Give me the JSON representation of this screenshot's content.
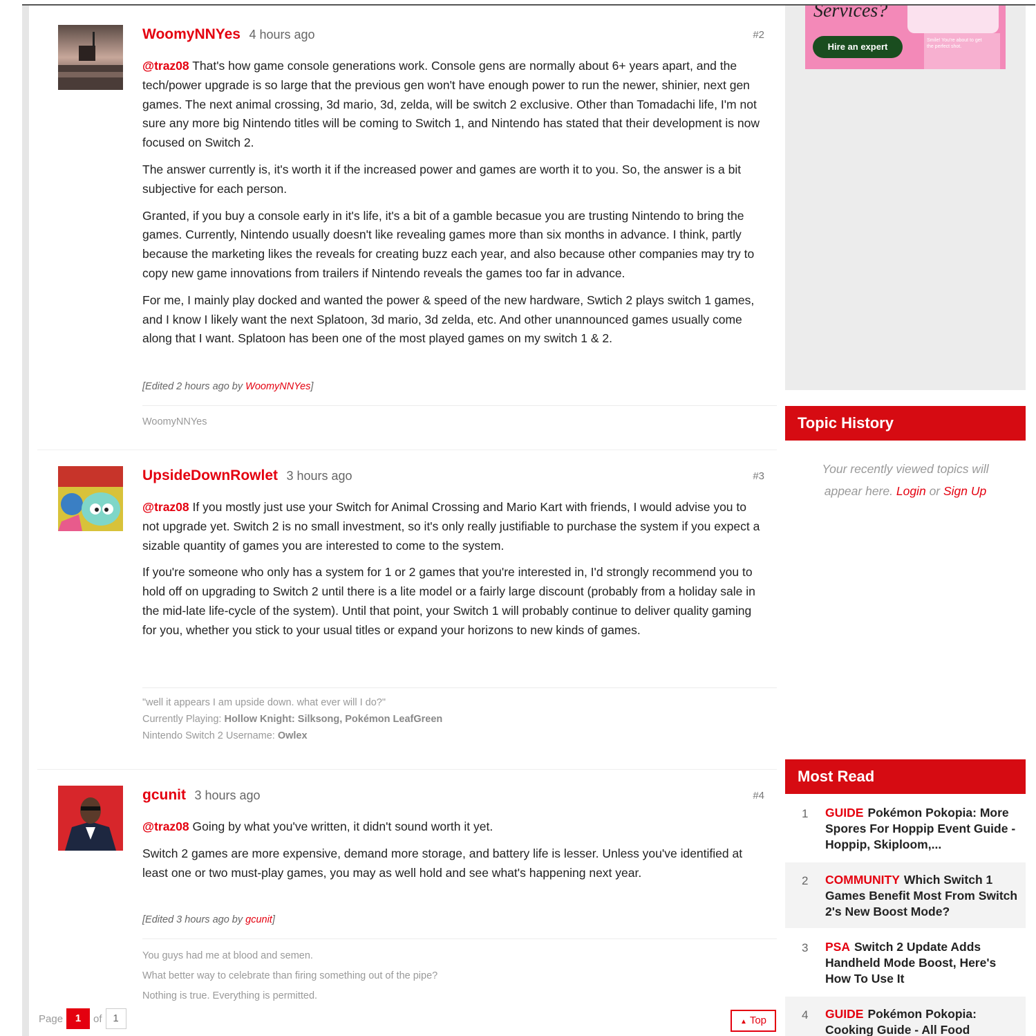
{
  "posts": [
    {
      "user": "WoomyNNYes",
      "ago": "4 hours ago",
      "num": "#2",
      "mention": "@traz08",
      "paragraphs": [
        "That's how game console generations work. Console gens are normally about 6+ years apart, and the tech/power upgrade is so large that the previous gen won't have enough power to run the newer, shinier, next gen games. The next animal crossing, 3d mario, 3d, zelda, will be switch 2 exclusive. Other than Tomadachi life, I'm not sure any more big Nintendo titles will be coming to Switch 1, and Nintendo has stated that their development is now focused on Switch 2.",
        "The answer currently is, it's worth it if the increased power and games are worth it to you. So, the answer is a bit subjective for each person.",
        "Granted, if you buy a console early in it's life, it's a bit of a gamble becasue you are trusting Nintendo to bring the games. Currently, Nintendo usually doesn't like revealing games more than six months in advance. I think, partly because the marketing likes the reveals for creating buzz each year, and also because other companies may try to copy new game innovations from trailers if Nintendo reveals the games too far in advance.",
        "For me, I mainly play docked and wanted the power & speed of the new hardware, Swtich 2 plays switch 1 games, and I know I likely want the next Splatoon, 3d mario, 3d zelda, etc. And other unannounced games usually come along that I want. Splatoon has been one of the most played games on my switch 1 & 2."
      ],
      "edited_prefix": "[Edited 2 hours ago by ",
      "edited_user": "WoomyNNYes",
      "edited_suffix": "]",
      "signature": "WoomyNNYes"
    },
    {
      "user": "UpsideDownRowlet",
      "ago": "3 hours ago",
      "num": "#3",
      "mention": "@traz08",
      "paragraphs": [
        "If you mostly just use your Switch for Animal Crossing and Mario Kart with friends, I would advise you to not upgrade yet. Switch 2 is no small investment, so it's only really justifiable to purchase the system if you expect a sizable quantity of games you are interested to come to the system.",
        "If you're someone who only has a system for 1 or 2 games that you're interested in, I'd strongly recommend you to hold off on upgrading to Switch 2 until there is a lite model or a fairly large discount (probably from a holiday sale in the mid-late life-cycle of the system). Until that point, your Switch 1 will probably continue to deliver quality gaming for you, whether you stick to your usual titles or expand your horizons to new kinds of games."
      ],
      "sig_quote": "\"well it appears I am upside down. what ever will I do?\"",
      "sig_playing_label": "Currently Playing: ",
      "sig_playing": "Hollow Knight: Silksong, Pokémon LeafGreen",
      "sig_username_label": "Nintendo Switch 2 Username: ",
      "sig_username": "Owlex"
    },
    {
      "user": "gcunit",
      "ago": "3 hours ago",
      "num": "#4",
      "mention": "@traz08",
      "paragraphs": [
        "Going by what you've written, it didn't sound worth it yet.",
        "Switch 2 games are more expensive, demand more storage, and battery life is lesser. Unless you've identified at least one or two must-play games, you may as well hold and see what's happening next year."
      ],
      "edited_prefix": "[Edited 3 hours ago by ",
      "edited_user": "gcunit",
      "edited_suffix": "]",
      "sig_lines": [
        "You guys had me at blood and semen.",
        "What better way to celebrate than firing something out of the pipe?",
        "Nothing is true. Everything is permitted."
      ]
    }
  ],
  "pager": {
    "page_label": "Page",
    "current": "1",
    "of_label": "of",
    "total": "1"
  },
  "top_button": "Top",
  "ad": {
    "title": "Services?",
    "button": "Hire an expert",
    "phone_text": "Smile! You're about to get the perfect shot."
  },
  "topic_history": {
    "title": "Topic History",
    "text1": "Your recently viewed topics will",
    "text2": "appear here.",
    "login": "Login",
    "or": "or",
    "signup": "Sign Up"
  },
  "most_read": {
    "title": "Most Read",
    "items": [
      {
        "n": "1",
        "cat": "GUIDE",
        "title": "Pokémon Pokopia: More Spores For Hoppip Event Guide - Hoppip, Skiploom,..."
      },
      {
        "n": "2",
        "cat": "COMMUNITY",
        "title": "Which Switch 1 Games Benefit Most From Switch 2's New Boost Mode?"
      },
      {
        "n": "3",
        "cat": "PSA",
        "title": "Switch 2 Update Adds Handheld Mode Boost, Here's How To Use It"
      },
      {
        "n": "4",
        "cat": "GUIDE",
        "title": "Pokémon Pokopia: Cooking Guide - All Food"
      }
    ]
  },
  "colors": {
    "accent": "#e4000f",
    "header_red": "#d60b12"
  }
}
